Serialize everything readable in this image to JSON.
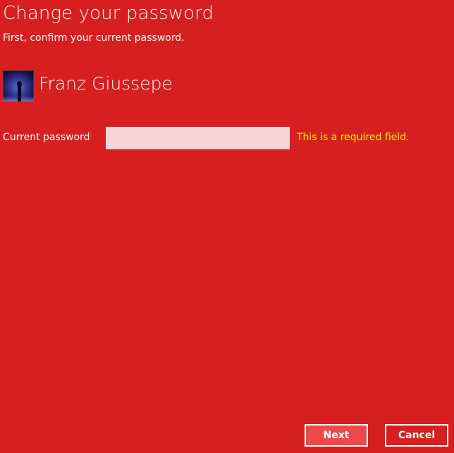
{
  "header": {
    "title": "Change your password",
    "subtitle": "First, confirm your current password."
  },
  "user": {
    "name": "Franz Giussepe",
    "avatar_icon": "user-avatar-silhouette"
  },
  "form": {
    "current_password_label": "Current password",
    "current_password_value": "",
    "error_message": "This is a required field."
  },
  "buttons": {
    "next_label": "Next",
    "cancel_label": "Cancel"
  },
  "colors": {
    "background": "#d71f1f",
    "input_background": "#f6d6d6",
    "error_text": "#fff200",
    "primary_button": "#ef4848"
  }
}
